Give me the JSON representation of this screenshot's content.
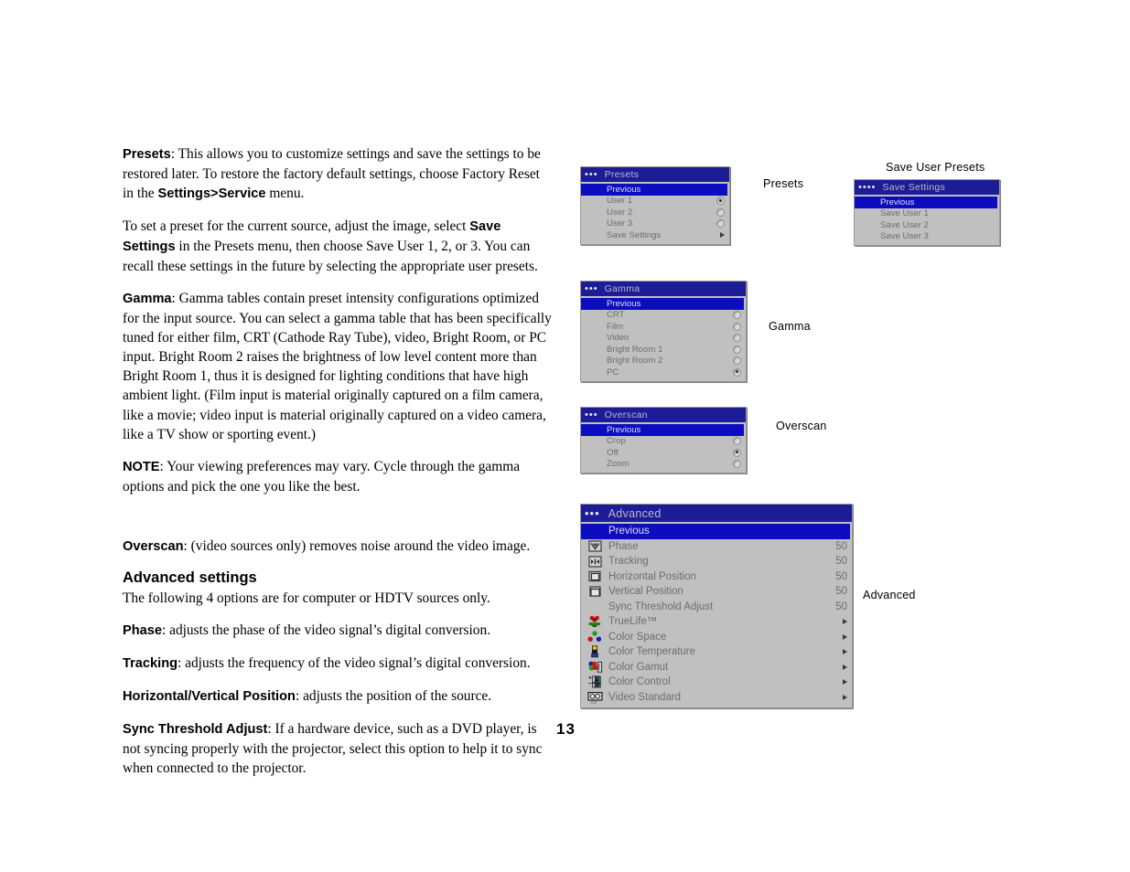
{
  "page": {
    "number": "13"
  },
  "article": {
    "paragraphs": [
      {
        "id": "presets-intro",
        "lead": "Presets",
        "text": ": This allows you to customize settings and save the settings to be restored later. To restore the factory default settings, choose Factory Reset in the ",
        "lead2": "Settings>Service",
        "text2": " menu."
      },
      {
        "id": "presets-howto",
        "text": "To set a preset for the current source, adjust the image, select ",
        "lead2": "Save Settings",
        "text2": " in the Presets menu, then choose Save User 1, 2, or 3. You can recall these settings in the future by selecting the appropriate user presets."
      },
      {
        "id": "gamma",
        "lead": "Gamma",
        "text": ": Gamma tables contain preset intensity configurations optimized for the input source. You can select a gamma table that has been specifically tuned for either film, CRT (Cathode Ray Tube), video, Bright Room, or PC input. Bright Room 2 raises the brightness of low level content more than Bright Room 1, thus it is designed for lighting conditions that have high ambient light. (Film input is material originally captured on a film camera, like a movie; video input is material originally captured on a video camera, like a TV show or sporting event.)"
      },
      {
        "id": "note",
        "lead": "NOTE",
        "text": ": Your viewing preferences may vary. Cycle through the gamma options and pick the one you like the best."
      },
      {
        "id": "overscan",
        "lead": "Overscan",
        "text": ": (video sources only) removes noise around the video image."
      }
    ],
    "advanced_heading": "Advanced settings",
    "advanced_intro": "The following 4 options are for computer or HDTV sources only.",
    "advanced_paragraphs": [
      {
        "id": "phase",
        "lead": "Phase",
        "text": ": adjusts the phase of the video signal’s digital conversion."
      },
      {
        "id": "tracking",
        "lead": "Tracking",
        "text": ": adjusts the frequency of the video signal’s digital conversion."
      },
      {
        "id": "hv-position",
        "lead": "Horizontal/Vertical Position",
        "text": ": adjusts the position of the source."
      },
      {
        "id": "sync-threshold",
        "lead": "Sync Threshold Adjust",
        "text": ": If a hardware device, such as a DVD player, is not syncing properly with the projector, select this option to help it to sync when connected to the projector."
      }
    ]
  },
  "captions": {
    "presets": "Presets",
    "save_user_presets": "Save User Presets",
    "gamma": "Gamma",
    "overscan": "Overscan",
    "advanced": "Advanced"
  },
  "colors": {
    "menu_titlebar": "#1c1c96",
    "menu_background": "#c0c0c0",
    "highlight_bar": "#0d0dc0",
    "menu_text": "#6d6d6d",
    "highlight_text": "#dedef5"
  },
  "menus": {
    "presets": {
      "dots": "•••",
      "title": "Presets",
      "rows": [
        {
          "label": "Previous",
          "control": "none",
          "highlight": true
        },
        {
          "label": "User 1",
          "control": "radio-on"
        },
        {
          "label": "User 2",
          "control": "radio-off"
        },
        {
          "label": "User 3",
          "control": "radio-off"
        },
        {
          "label": "Save Settings",
          "control": "arrow"
        }
      ]
    },
    "save_user_presets": {
      "dots": "••••",
      "title": "Save Settings",
      "rows": [
        {
          "label": "Previous",
          "control": "none",
          "highlight": true
        },
        {
          "label": "Save User 1",
          "control": "none"
        },
        {
          "label": "Save User 2",
          "control": "none"
        },
        {
          "label": "Save User 3",
          "control": "none"
        }
      ]
    },
    "gamma": {
      "dots": "•••",
      "title": "Gamma",
      "rows": [
        {
          "label": "Previous",
          "control": "none",
          "highlight": true
        },
        {
          "label": "CRT",
          "control": "radio-off"
        },
        {
          "label": "Film",
          "control": "radio-off"
        },
        {
          "label": "Video",
          "control": "radio-off"
        },
        {
          "label": "Bright Room 1",
          "control": "radio-off"
        },
        {
          "label": "Bright Room 2",
          "control": "radio-off"
        },
        {
          "label": "PC",
          "control": "radio-on"
        }
      ]
    },
    "overscan": {
      "dots": "•••",
      "title": "Overscan",
      "rows": [
        {
          "label": "Previous",
          "control": "none",
          "highlight": true
        },
        {
          "label": "Crop",
          "control": "radio-off"
        },
        {
          "label": "Off",
          "control": "radio-on"
        },
        {
          "label": "Zoom",
          "control": "radio-off"
        }
      ]
    },
    "advanced": {
      "dots": "•••",
      "title": "Advanced",
      "rows": [
        {
          "label": "Previous",
          "icon": "none",
          "value": "",
          "control": "none",
          "highlight": true
        },
        {
          "label": "Phase",
          "icon": "phase-icon",
          "value": "50",
          "control": "value"
        },
        {
          "label": "Tracking",
          "icon": "tracking-icon",
          "value": "50",
          "control": "value"
        },
        {
          "label": "Horizontal Position",
          "icon": "horizontal-position-icon",
          "value": "50",
          "control": "value"
        },
        {
          "label": "Vertical Position",
          "icon": "vertical-position-icon",
          "value": "50",
          "control": "value"
        },
        {
          "label": "Sync Threshold Adjust",
          "icon": "none",
          "value": "50",
          "control": "value"
        },
        {
          "label": "TrueLife™",
          "icon": "truelife-flower-icon",
          "value": "",
          "control": "arrow"
        },
        {
          "label": "Color Space",
          "icon": "color-space-icon",
          "value": "",
          "control": "arrow"
        },
        {
          "label": "Color Temperature",
          "icon": "color-temperature-icon",
          "value": "",
          "control": "arrow"
        },
        {
          "label": "Color Gamut",
          "icon": "color-gamut-icon",
          "value": "",
          "control": "arrow"
        },
        {
          "label": "Color Control",
          "icon": "color-control-icon",
          "value": "",
          "control": "arrow"
        },
        {
          "label": "Video Standard",
          "icon": "video-standard-icon",
          "value": "",
          "control": "arrow"
        }
      ]
    }
  }
}
